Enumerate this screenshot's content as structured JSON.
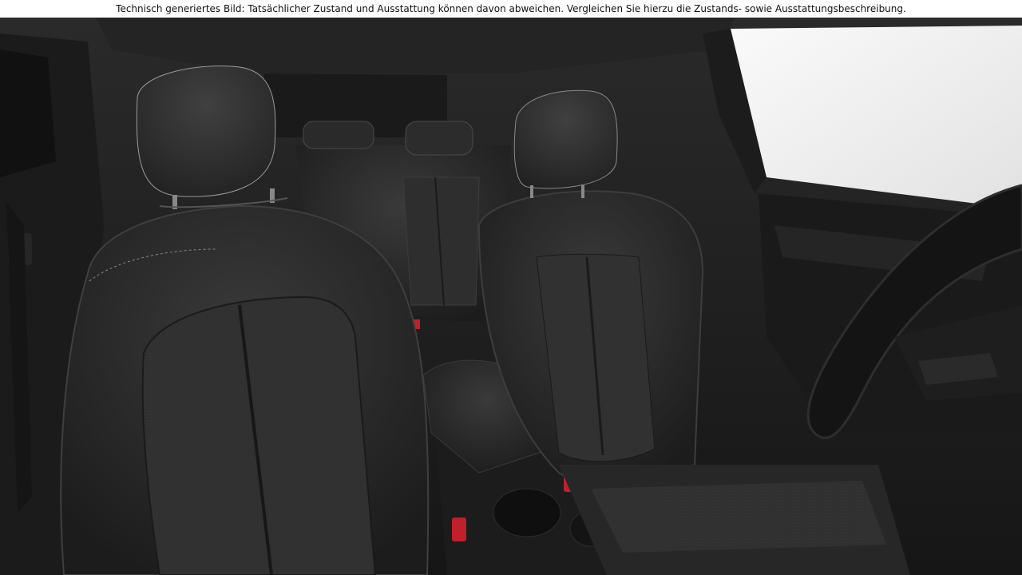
{
  "disclaimer": {
    "text": "Technisch generiertes Bild: Tatsächlicher Zustand und Ausstattung können davon abweichen. Vergleichen Sie hierzu die Zustands- sowie Ausstattungsbeschreibung."
  },
  "colors": {
    "background": "#ffffff",
    "interior_dark": "#1f1f1f",
    "seat_leather": "#2b2b2b",
    "seat_fabric": "#333333",
    "stitching": "#8a8a8a",
    "buckle_red": "#c0202a",
    "window_light": "#eeeeee"
  },
  "icons": [
    "seat-icon",
    "steering-wheel-icon",
    "seatbelt-buckle-icon"
  ]
}
